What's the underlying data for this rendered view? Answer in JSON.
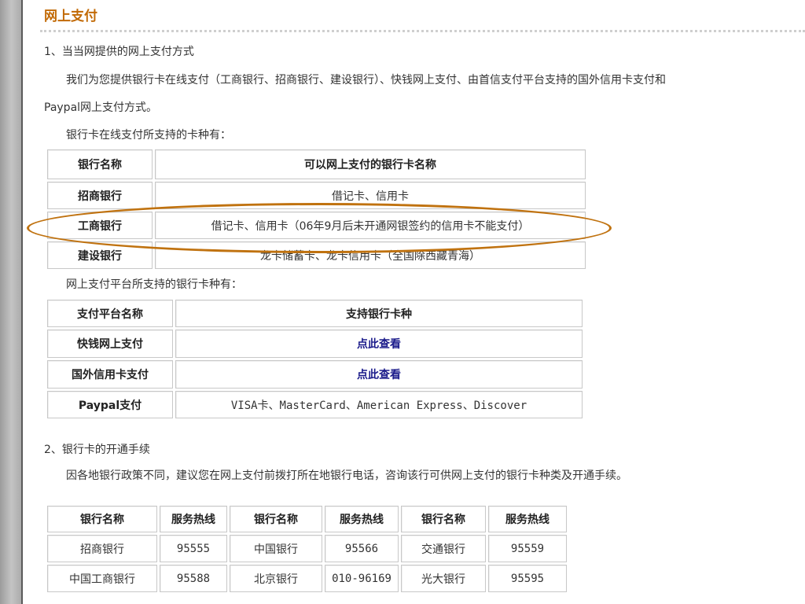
{
  "page": {
    "title": "网上支付",
    "section1_heading": "1、当当网提供的网上支付方式",
    "intro_line1": "我们为您提供银行卡在线支付（工商银行、招商银行、建设银行）、快钱网上支付、由首信支付平台支持的国外信用卡支付和",
    "intro_line2": "Paypal网上支付方式。",
    "bank_cards_caption": "银行卡在线支付所支持的卡种有：",
    "platform_cards_caption": "网上支付平台所支持的银行卡种有：",
    "section2_heading": "2、银行卡的开通手续",
    "section2_text": "因各地银行政策不同，建议您在网上支付前拨打所在地银行电话，咨询该行可供网上支付的银行卡种类及开通手续。"
  },
  "bank_table": {
    "headers": [
      "银行名称",
      "可以网上支付的银行卡名称"
    ],
    "rows": [
      [
        "招商银行",
        "借记卡、信用卡"
      ],
      [
        "工商银行",
        "借记卡、信用卡（06年9月后未开通网银签约的信用卡不能支付）"
      ],
      [
        "建设银行",
        "龙卡储蓄卡、龙卡信用卡（全国除西藏青海）"
      ]
    ]
  },
  "platform_table": {
    "headers": [
      "支付平台名称",
      "支持银行卡种"
    ],
    "rows": [
      [
        "快钱网上支付",
        "点此查看"
      ],
      [
        "国外信用卡支付",
        "点此查看"
      ],
      [
        "Paypal支付",
        "VISA卡、MasterCard、American Express、Discover"
      ]
    ]
  },
  "hotline_table": {
    "headers": [
      "银行名称",
      "服务热线",
      "银行名称",
      "服务热线",
      "银行名称",
      "服务热线"
    ],
    "rows": [
      [
        "招商银行",
        "95555",
        "中国银行",
        "95566",
        "交通银行",
        "95559"
      ],
      [
        "中国工商银行",
        "95588",
        "北京银行",
        "010-96169",
        "光大银行",
        "95595"
      ]
    ]
  },
  "colors": {
    "title": "#c26a06",
    "highlight_oval": "#c0720f",
    "link": "#1a1a8a"
  }
}
